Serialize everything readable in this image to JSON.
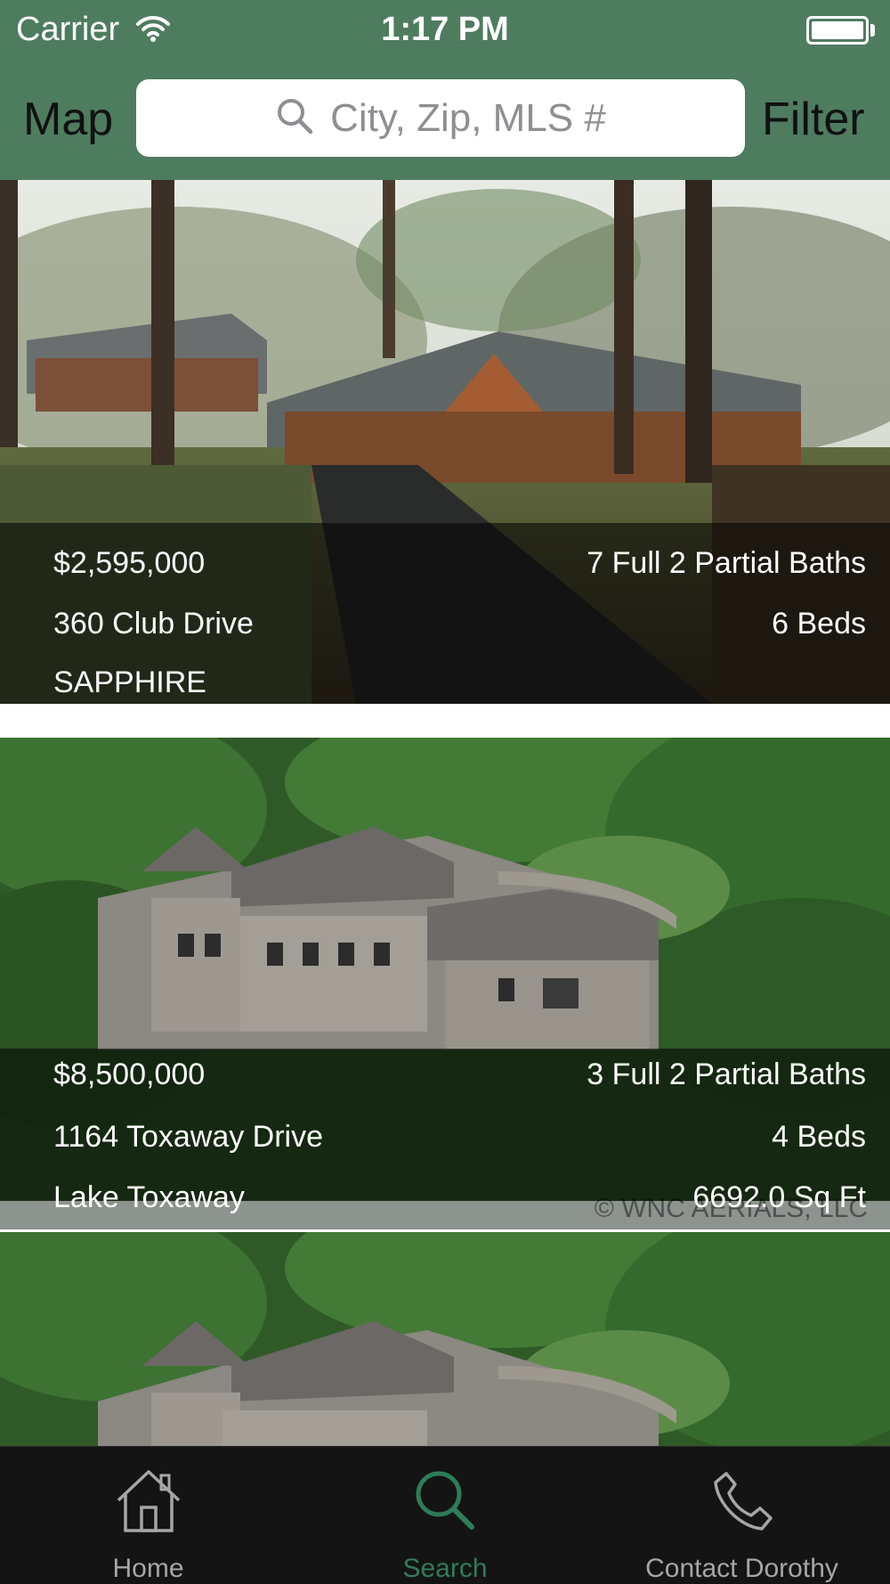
{
  "status_bar": {
    "carrier": "Carrier",
    "time": "1:17 PM"
  },
  "nav": {
    "map_label": "Map",
    "filter_label": "Filter",
    "search_placeholder": "City, Zip, MLS #"
  },
  "listings": [
    {
      "price": "$2,595,000",
      "baths": "7 Full 2 Partial Baths",
      "address": "360 Club Drive",
      "beds": "6 Beds",
      "city": "SAPPHIRE"
    },
    {
      "price": "$8,500,000",
      "baths": "3 Full 2 Partial Baths",
      "address": "1164 Toxaway Drive",
      "beds": "4 Beds",
      "city": "Lake Toxaway",
      "sqft": "6692.0 Sq Ft",
      "watermark": "© WNC AERIALS, LLC"
    }
  ],
  "tabs": [
    {
      "label": "Home",
      "icon": "house-icon"
    },
    {
      "label": "Search",
      "icon": "search-icon",
      "selected": true
    },
    {
      "label": "Contact Dorothy",
      "icon": "phone-icon"
    }
  ],
  "colors": {
    "header_green": "#4e7c5f",
    "tab_active": "#2e7c59",
    "tab_inactive": "#a6a6a6",
    "tab_bar_bg": "#141414"
  }
}
